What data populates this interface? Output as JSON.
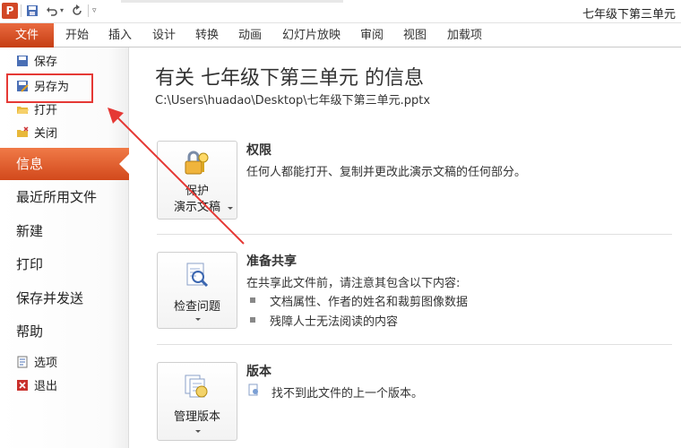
{
  "window": {
    "title": "七年级下第三单元"
  },
  "quick_access": {
    "save_icon": "save-icon",
    "undo_icon": "undo-icon",
    "redo_icon": "redo-icon"
  },
  "ribbon": {
    "file_tab": "文件",
    "tabs": [
      "开始",
      "插入",
      "设计",
      "转换",
      "动画",
      "幻灯片放映",
      "审阅",
      "视图",
      "加载项"
    ]
  },
  "nav": {
    "save": "保存",
    "save_as": "另存为",
    "open": "打开",
    "close": "关闭",
    "info": "信息",
    "recent": "最近所用文件",
    "new": "新建",
    "print": "打印",
    "save_send": "保存并发送",
    "help": "帮助",
    "options": "选项",
    "exit": "退出"
  },
  "main": {
    "title": "有关 七年级下第三单元 的信息",
    "path": "C:\\Users\\huadao\\Desktop\\七年级下第三单元.pptx",
    "permissions": {
      "button_line1": "保护",
      "button_line2": "演示文稿",
      "heading": "权限",
      "text": "任何人都能打开、复制并更改此演示文稿的任何部分。"
    },
    "prepare": {
      "button": "检查问题",
      "heading": "准备共享",
      "text": "在共享此文件前，请注意其包含以下内容:",
      "items": [
        "文档属性、作者的姓名和裁剪图像数据",
        "残障人士无法阅读的内容"
      ]
    },
    "versions": {
      "button": "管理版本",
      "heading": "版本",
      "text": "找不到此文件的上一个版本。"
    }
  },
  "colors": {
    "accent": "#d2491c",
    "highlight_box": "#e53935"
  }
}
